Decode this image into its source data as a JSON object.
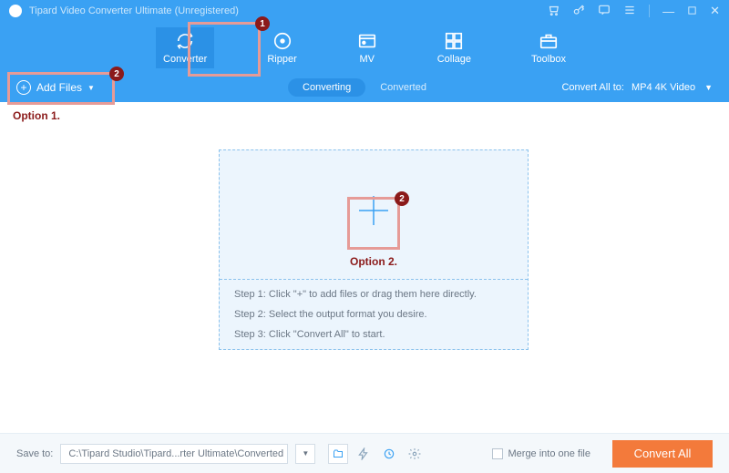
{
  "titlebar": {
    "title": "Tipard Video Converter Ultimate (Unregistered)"
  },
  "nav": {
    "converter": "Converter",
    "ripper": "Ripper",
    "mv": "MV",
    "collage": "Collage",
    "toolbox": "Toolbox"
  },
  "subbar": {
    "add_files": "Add Files",
    "tab_converting": "Converting",
    "tab_converted": "Converted",
    "convert_all_to_label": "Convert All to:",
    "convert_all_to_value": "MP4 4K Video"
  },
  "dropzone": {
    "step1": "Step 1: Click \"+\" to add files or drag them here directly.",
    "step2": "Step 2: Select the output format you desire.",
    "step3": "Step 3: Click \"Convert All\" to start."
  },
  "footer": {
    "save_to_label": "Save to:",
    "save_to_path": "C:\\Tipard Studio\\Tipard...rter Ultimate\\Converted",
    "merge_label": "Merge into one file",
    "convert_all": "Convert All"
  },
  "annotations": {
    "option1": "Option 1.",
    "option2": "Option 2.",
    "b1": "1",
    "b2": "2"
  }
}
